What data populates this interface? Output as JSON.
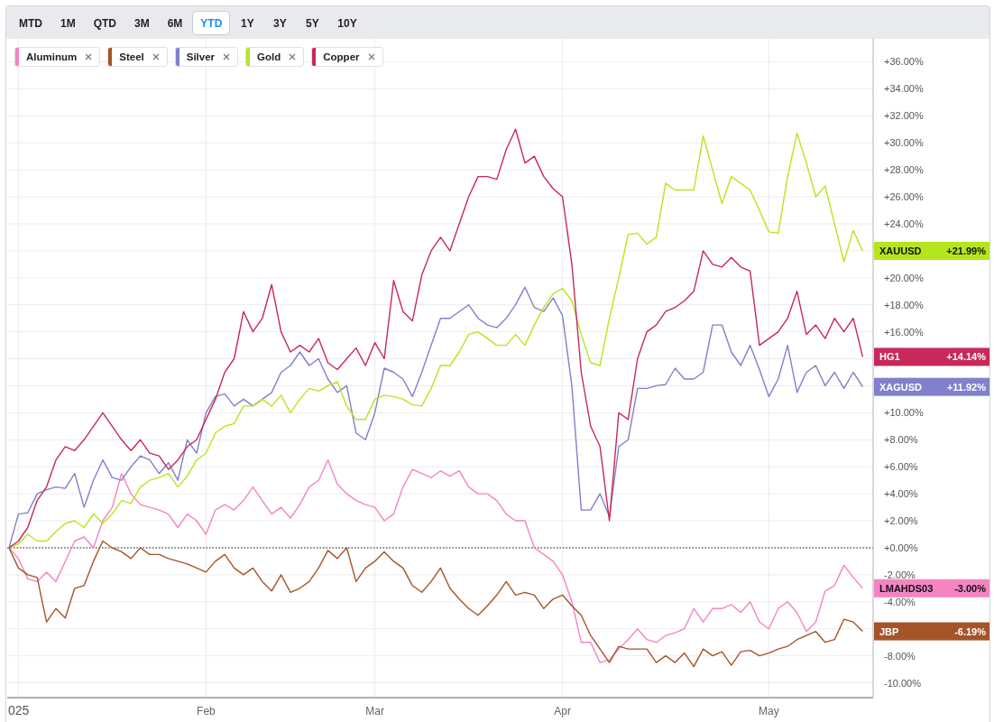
{
  "range_tabs": [
    {
      "label": "MTD",
      "selected": false
    },
    {
      "label": "1M",
      "selected": false
    },
    {
      "label": "QTD",
      "selected": false
    },
    {
      "label": "3M",
      "selected": false
    },
    {
      "label": "6M",
      "selected": false
    },
    {
      "label": "YTD",
      "selected": true
    },
    {
      "label": "1Y",
      "selected": false
    },
    {
      "label": "3Y",
      "selected": false
    },
    {
      "label": "5Y",
      "selected": false
    },
    {
      "label": "10Y",
      "selected": false
    }
  ],
  "chart": {
    "chart_data": {
      "type": "line",
      "categories": [
        null,
        "025",
        null,
        null,
        null,
        null,
        null,
        null,
        null,
        null,
        null,
        null,
        null,
        null,
        null,
        null,
        null,
        null,
        null,
        null,
        null,
        "Feb",
        null,
        null,
        null,
        null,
        null,
        null,
        null,
        null,
        null,
        null,
        null,
        null,
        null,
        null,
        null,
        null,
        null,
        "Mar",
        null,
        null,
        null,
        null,
        null,
        null,
        null,
        null,
        null,
        null,
        null,
        null,
        null,
        null,
        null,
        null,
        null,
        null,
        null,
        "Apr",
        null,
        null,
        null,
        null,
        null,
        null,
        null,
        null,
        null,
        null,
        null,
        null,
        null,
        null,
        null,
        null,
        null,
        null,
        null,
        null,
        null,
        "May",
        null,
        null,
        null,
        null,
        null,
        null,
        null,
        null,
        null,
        null
      ],
      "series": [
        {
          "name": "Aluminum",
          "color": "#f584c3",
          "values": [
            0,
            -0.8,
            -2.3,
            -2.5,
            -1.8,
            -2.5,
            -1,
            0.5,
            0.8,
            0,
            2,
            3,
            5.5,
            4,
            3.2,
            3,
            2.8,
            2.5,
            1.5,
            2.5,
            2,
            1,
            2.8,
            3.2,
            2.8,
            3.5,
            4.5,
            3.5,
            2.5,
            3,
            2.2,
            3.2,
            4.5,
            5,
            6.5,
            4.7,
            4,
            3.5,
            3.2,
            3,
            2,
            2.5,
            4.5,
            5.8,
            5.5,
            5.2,
            5.7,
            5.3,
            5.7,
            4.5,
            4,
            4,
            3.5,
            2.5,
            2,
            2,
            0,
            -0.5,
            -1,
            -2,
            -4,
            -7,
            -7,
            -8.5,
            -8.3,
            -7.5,
            -6.8,
            -6,
            -6.8,
            -7,
            -6.5,
            -6.3,
            -6,
            -4.5,
            -5.5,
            -4.5,
            -4.5,
            -4.2,
            -4.8,
            -4,
            -5.5,
            -6,
            -4.5,
            -4,
            -4.8,
            -6.2,
            -5.5,
            -3.2,
            -2.8,
            -1.3,
            -2.2,
            -3
          ]
        },
        {
          "name": "Steel",
          "color": "#a5542a",
          "values": [
            0,
            -1.5,
            -2,
            -2.2,
            -5.5,
            -4.5,
            -5.2,
            -3,
            -2.8,
            -1,
            0.5,
            0,
            -0.3,
            -0.8,
            0,
            -0.5,
            -0.5,
            -0.8,
            -1,
            -1.2,
            -1.5,
            -1.8,
            -1,
            -0.5,
            -1.5,
            -2,
            -1.5,
            -2.5,
            -3.2,
            -2,
            -3.3,
            -3,
            -2.5,
            -1.5,
            -0.2,
            -0.8,
            0,
            -2.5,
            -1.5,
            -1,
            -0.3,
            -1,
            -1.5,
            -2.8,
            -3.3,
            -2.5,
            -1.5,
            -3,
            -3.8,
            -4.5,
            -5,
            -4.3,
            -3.5,
            -2.5,
            -3.5,
            -3.3,
            -3.5,
            -4.5,
            -3.8,
            -3.5,
            -4.3,
            -5,
            -6.5,
            -7.5,
            -8.5,
            -7.3,
            -7.5,
            -7.5,
            -7.5,
            -8.5,
            -8,
            -8.5,
            -7.8,
            -8.8,
            -7.5,
            -8,
            -7.7,
            -8.7,
            -7.7,
            -7.6,
            -8,
            -7.8,
            -7.5,
            -7.3,
            -6.8,
            -6.5,
            -6.2,
            -7,
            -6.8,
            -5.3,
            -5.5,
            -6.19
          ]
        },
        {
          "name": "Silver",
          "color": "#8080cc",
          "values": [
            0,
            2.5,
            2.6,
            4,
            4.3,
            4.5,
            4.4,
            5.5,
            3,
            5,
            6.5,
            5.2,
            5,
            6,
            6.8,
            6.5,
            5.5,
            6.3,
            5,
            8,
            7,
            10,
            11.2,
            11.4,
            10.5,
            11,
            10.5,
            11,
            11.5,
            13,
            13.5,
            14.5,
            13.5,
            14,
            12.5,
            11.5,
            12,
            8.5,
            8,
            10,
            13.3,
            13,
            12.5,
            11.2,
            13,
            15,
            17,
            17,
            17.5,
            18,
            17,
            16.5,
            16.3,
            17,
            18,
            19.3,
            17.8,
            17.5,
            18.5,
            17.2,
            12,
            2.8,
            2.8,
            4,
            2.3,
            7.5,
            8,
            11.8,
            11.8,
            12,
            12.1,
            13.3,
            12.5,
            12.5,
            13,
            16.5,
            16.5,
            14.5,
            13.5,
            15,
            13.2,
            11.2,
            12.5,
            15,
            11.5,
            13,
            13.5,
            12,
            13,
            11.8,
            13,
            11.92
          ]
        },
        {
          "name": "Gold",
          "color": "#b5e61d",
          "values": [
            0,
            0.3,
            1,
            0.5,
            0.5,
            1.2,
            1.8,
            2,
            1.5,
            2.5,
            1.8,
            2.5,
            3.5,
            3.3,
            4.5,
            5,
            5.2,
            5.5,
            4.5,
            5.3,
            6.5,
            7,
            8.5,
            9,
            9.2,
            10.5,
            10.5,
            11,
            10.5,
            11.3,
            10,
            11,
            11.8,
            11.6,
            12,
            12.3,
            10.5,
            9.5,
            9.5,
            11,
            11.3,
            11.2,
            11,
            10.6,
            10.5,
            11.8,
            13.5,
            13.5,
            14.5,
            15.8,
            16,
            15.5,
            15,
            15,
            15.8,
            15,
            16.5,
            17.8,
            18.8,
            19.2,
            18.3,
            15.8,
            13.7,
            13.5,
            17,
            20,
            23.2,
            23.3,
            22.5,
            23,
            27,
            26.5,
            26.5,
            26.5,
            30.5,
            28,
            25.5,
            27.5,
            27,
            26.5,
            25,
            23.4,
            23.3,
            27.5,
            30.7,
            28.5,
            26,
            26.8,
            24,
            21.2,
            23.5,
            21.99
          ]
        },
        {
          "name": "Copper",
          "color": "#c8285a",
          "values": [
            0,
            0.5,
            1.5,
            3.5,
            4.5,
            6.5,
            7.5,
            7.2,
            8,
            9,
            10,
            9,
            8,
            7.2,
            8,
            7,
            6.8,
            5.8,
            6.5,
            7.5,
            8,
            9.5,
            11,
            13,
            14,
            17.5,
            16,
            17,
            19.5,
            16,
            14.5,
            15,
            14.5,
            15.5,
            13.7,
            13.2,
            14,
            14.8,
            13.5,
            15.2,
            14,
            19.8,
            17.5,
            16.8,
            20.2,
            22,
            23,
            22,
            24,
            26,
            27.5,
            27.5,
            27.3,
            29.5,
            31,
            28.5,
            29,
            27.5,
            26.6,
            26,
            21,
            13,
            9,
            7.5,
            2,
            10,
            9.5,
            14,
            16,
            16.5,
            17.5,
            17.8,
            18.3,
            19,
            22,
            21,
            20.8,
            21.5,
            20.8,
            20.5,
            15,
            15.5,
            16,
            17,
            19,
            15.8,
            16.5,
            15.5,
            17,
            16,
            17,
            14.14
          ]
        }
      ],
      "yticks": [
        {
          "value": 36,
          "label": "+36.00%"
        },
        {
          "value": 34,
          "label": "+34.00%"
        },
        {
          "value": 32,
          "label": "+32.00%"
        },
        {
          "value": 30,
          "label": "+30.00%"
        },
        {
          "value": 28,
          "label": "+28.00%"
        },
        {
          "value": 26,
          "label": "+26.00%"
        },
        {
          "value": 24,
          "label": "+24.00%"
        },
        {
          "value": 20,
          "label": "+20.00%"
        },
        {
          "value": 18,
          "label": "+18.00%"
        },
        {
          "value": 16,
          "label": "+16.00%"
        },
        {
          "value": 10,
          "label": "+10.00%"
        },
        {
          "value": 8,
          "label": "+8.00%"
        },
        {
          "value": 6,
          "label": "+6.00%"
        },
        {
          "value": 4,
          "label": "+4.00%"
        },
        {
          "value": 2,
          "label": "+2.00%"
        },
        {
          "value": 0,
          "label": "+0.00%"
        },
        {
          "value": -2,
          "label": "-2.00%"
        },
        {
          "value": -4,
          "label": "-4.00%"
        },
        {
          "value": -8,
          "label": "-8.00%"
        },
        {
          "value": -10,
          "label": "-10.00%"
        }
      ],
      "ylim": [
        -11.1,
        37.7
      ],
      "grid": true,
      "legend": "upper left",
      "ref_lines": [
        {
          "axis": "y",
          "value": 0,
          "color": "#222222"
        }
      ]
    },
    "price_tags": [
      {
        "symbol": "XAUUSD",
        "value": "+21.99%",
        "color": "#b5e61d",
        "dark_text": true
      },
      {
        "symbol": "HG1",
        "value": "+14.14%",
        "color": "#c8285a",
        "dark_text": false
      },
      {
        "symbol": "XAGUSD",
        "value": "+11.92%",
        "color": "#8080cc",
        "dark_text": false
      },
      {
        "symbol": "LMAHDS03",
        "value": "-3.00%",
        "color": "#f584c3",
        "dark_text": true
      },
      {
        "symbol": "JBP",
        "value": "-6.19%",
        "color": "#a5542a",
        "dark_text": false
      }
    ]
  }
}
